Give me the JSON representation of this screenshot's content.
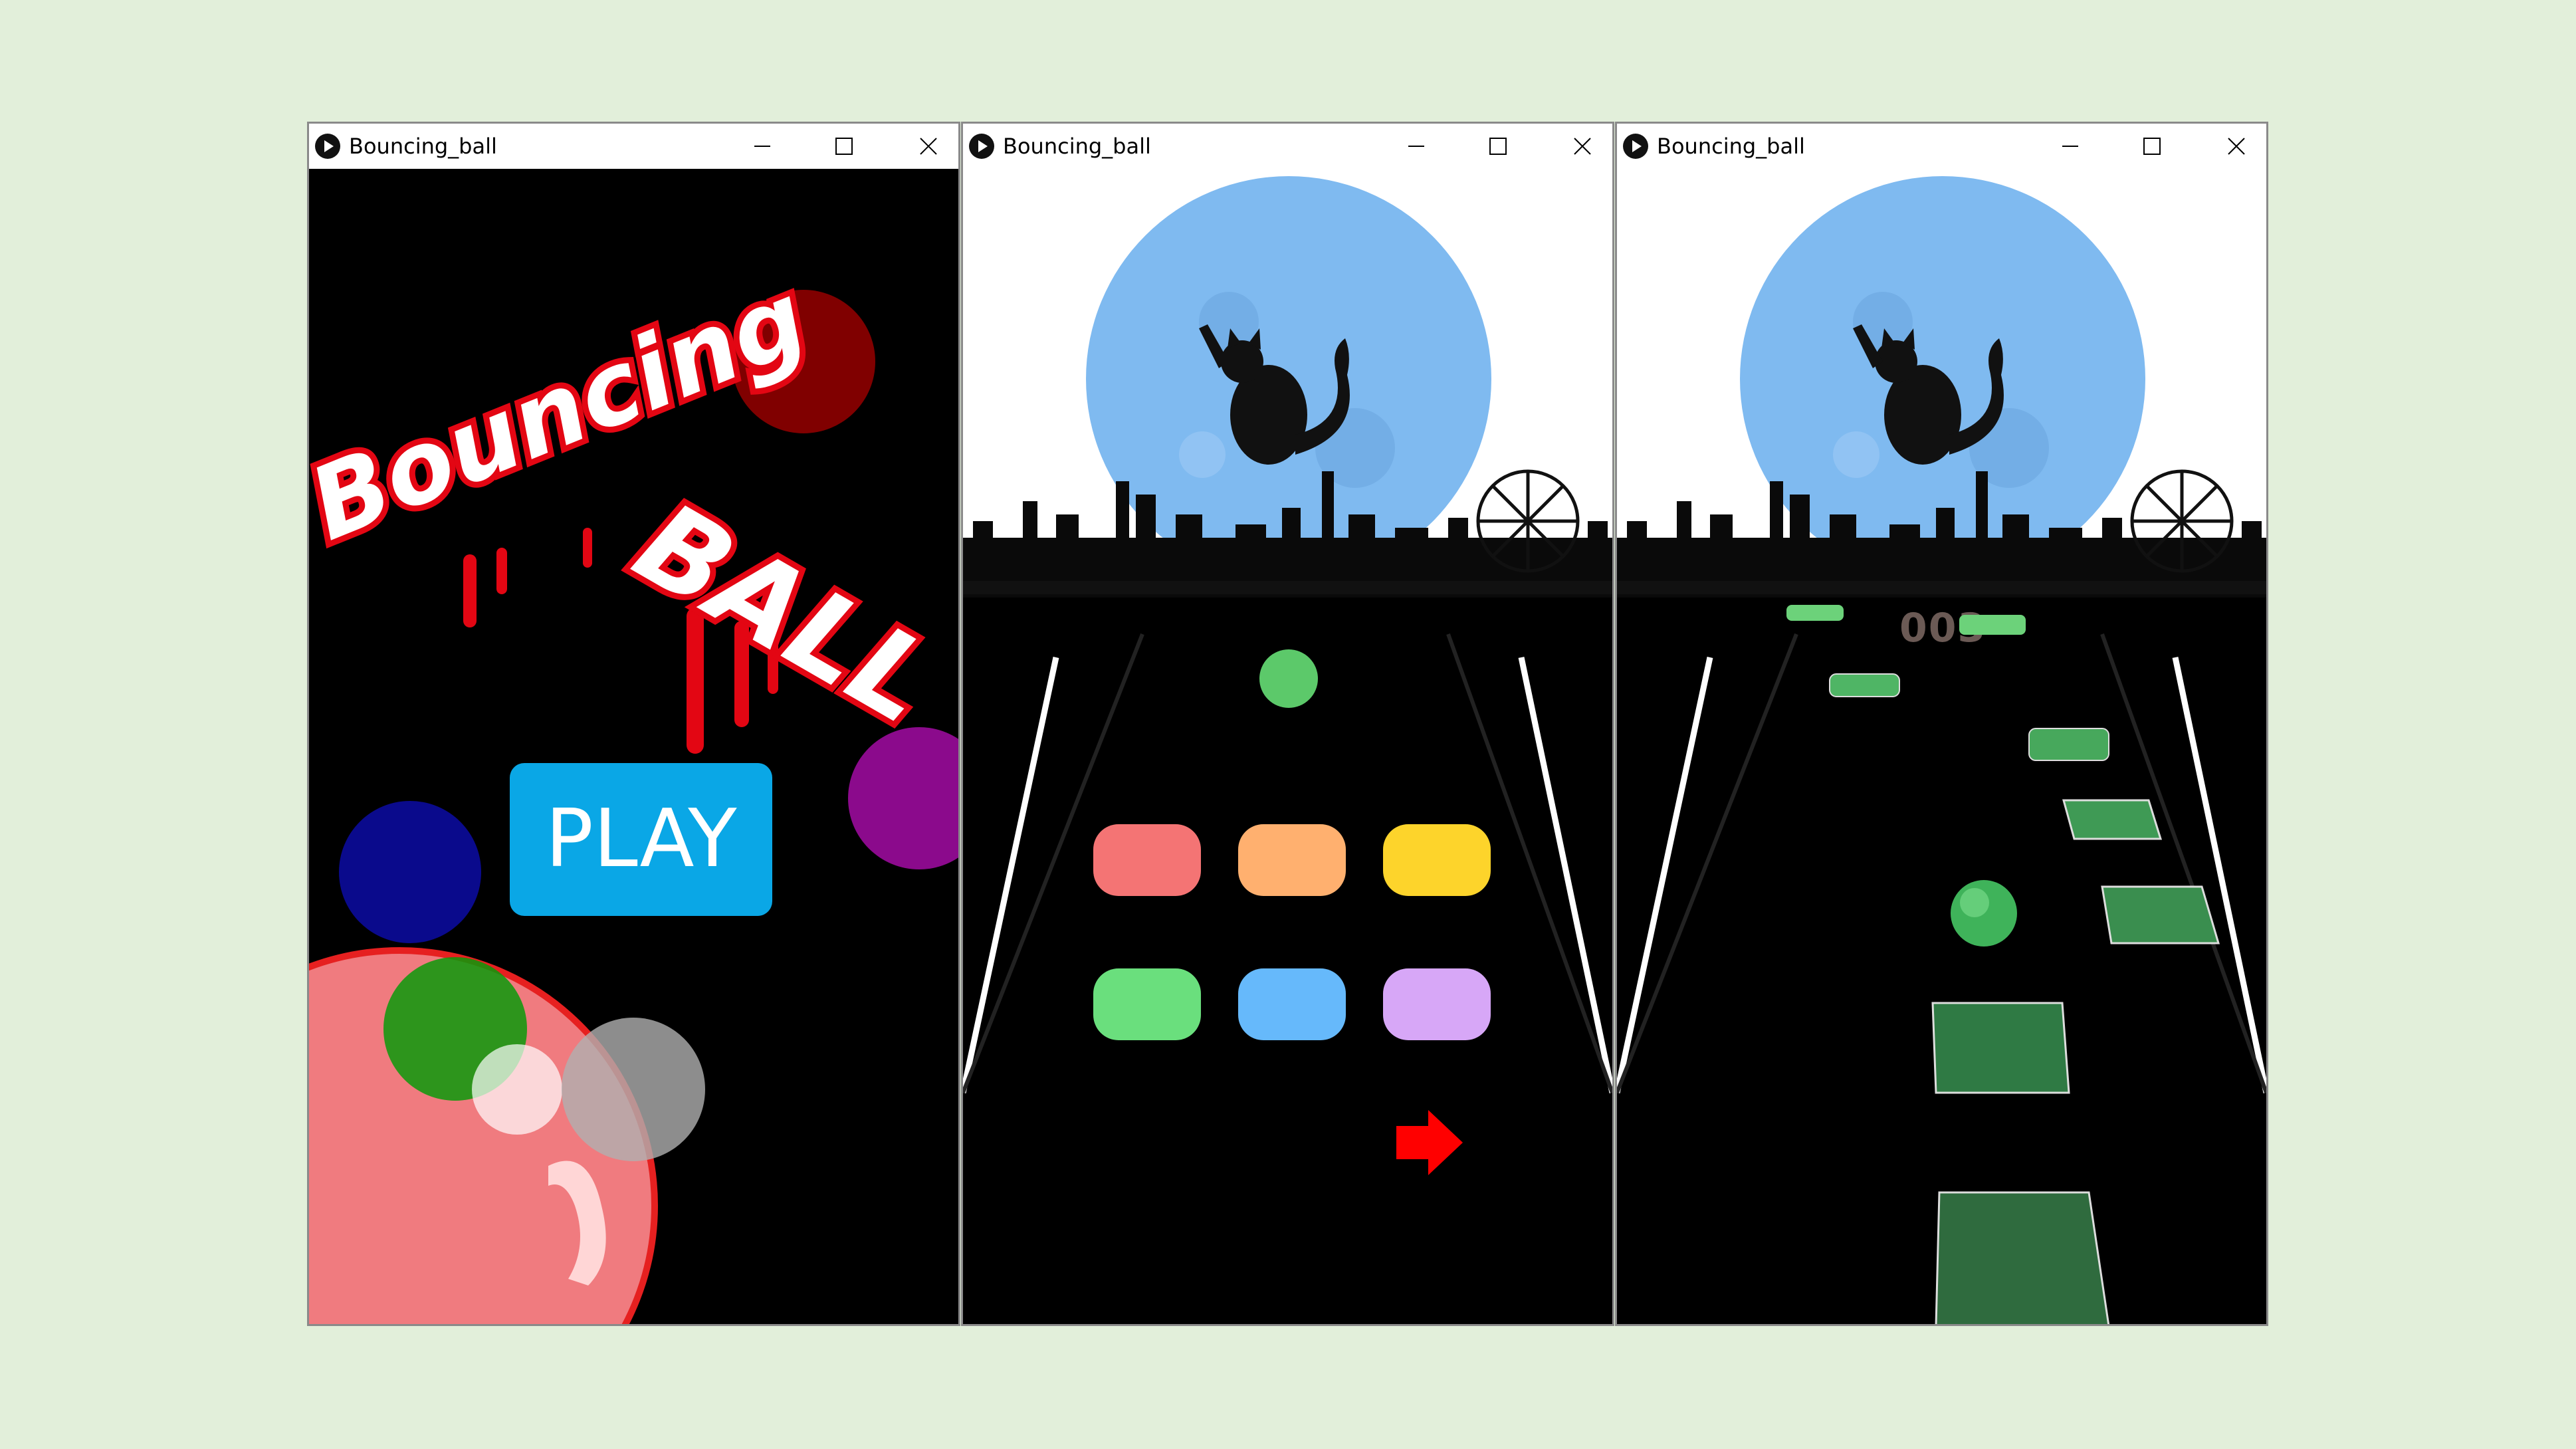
{
  "windows": [
    {
      "title": "Bouncing_ball",
      "screen": "title-screen",
      "logo_text": "Bouncing BALL",
      "play_label": "PLAY"
    },
    {
      "title": "Bouncing_ball",
      "screen": "color-select",
      "ball_colors": [
        {
          "name": "red",
          "hex": "#f47474"
        },
        {
          "name": "orange",
          "hex": "#ffb06f"
        },
        {
          "name": "yellow",
          "hex": "#fdd42b"
        },
        {
          "name": "green",
          "hex": "#6adf7d"
        },
        {
          "name": "blue",
          "hex": "#66b9fb"
        },
        {
          "name": "purple",
          "hex": "#d7a7f7"
        }
      ],
      "next_icon": "right-arrow-icon"
    },
    {
      "title": "Bouncing_ball",
      "screen": "gameplay",
      "score": "003"
    }
  ],
  "colors": {
    "background": "#e2efda",
    "play_button": "#0aa7e6",
    "moon": "#7fbaf0",
    "platform": "#2f6b3e",
    "platform_far": "#6cd27a",
    "next_arrow": "#ff0000"
  }
}
